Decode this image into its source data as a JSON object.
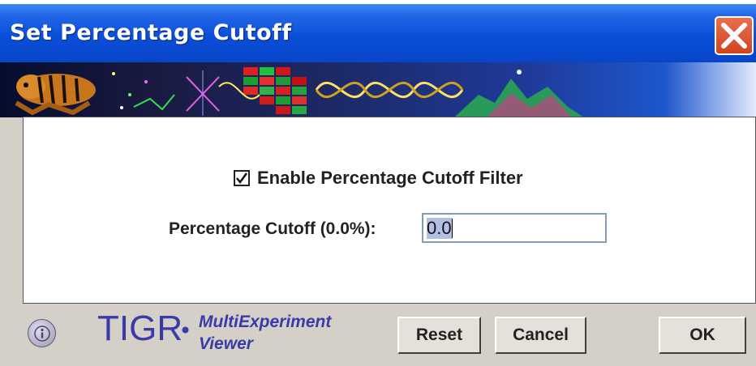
{
  "window": {
    "title": "Set Percentage Cutoff",
    "close_icon": "close-x-icon"
  },
  "banner": {
    "description_icon": "tigr-banner-image"
  },
  "form": {
    "enable_checkbox_label": "Enable Percentage Cutoff Filter",
    "enable_checked": true,
    "cutoff_label": "Percentage Cutoff (0.0%):",
    "cutoff_value": "0.0"
  },
  "footer": {
    "info_icon": "info-icon",
    "brand": "TIGR",
    "product_line1": "MultiExperiment",
    "product_line2": "Viewer",
    "reset_label": "Reset",
    "cancel_label": "Cancel",
    "ok_label": "OK"
  },
  "colors": {
    "titlebar": "#0a4fd9",
    "close_button": "#d1441f",
    "brand": "#3a3aa8"
  }
}
